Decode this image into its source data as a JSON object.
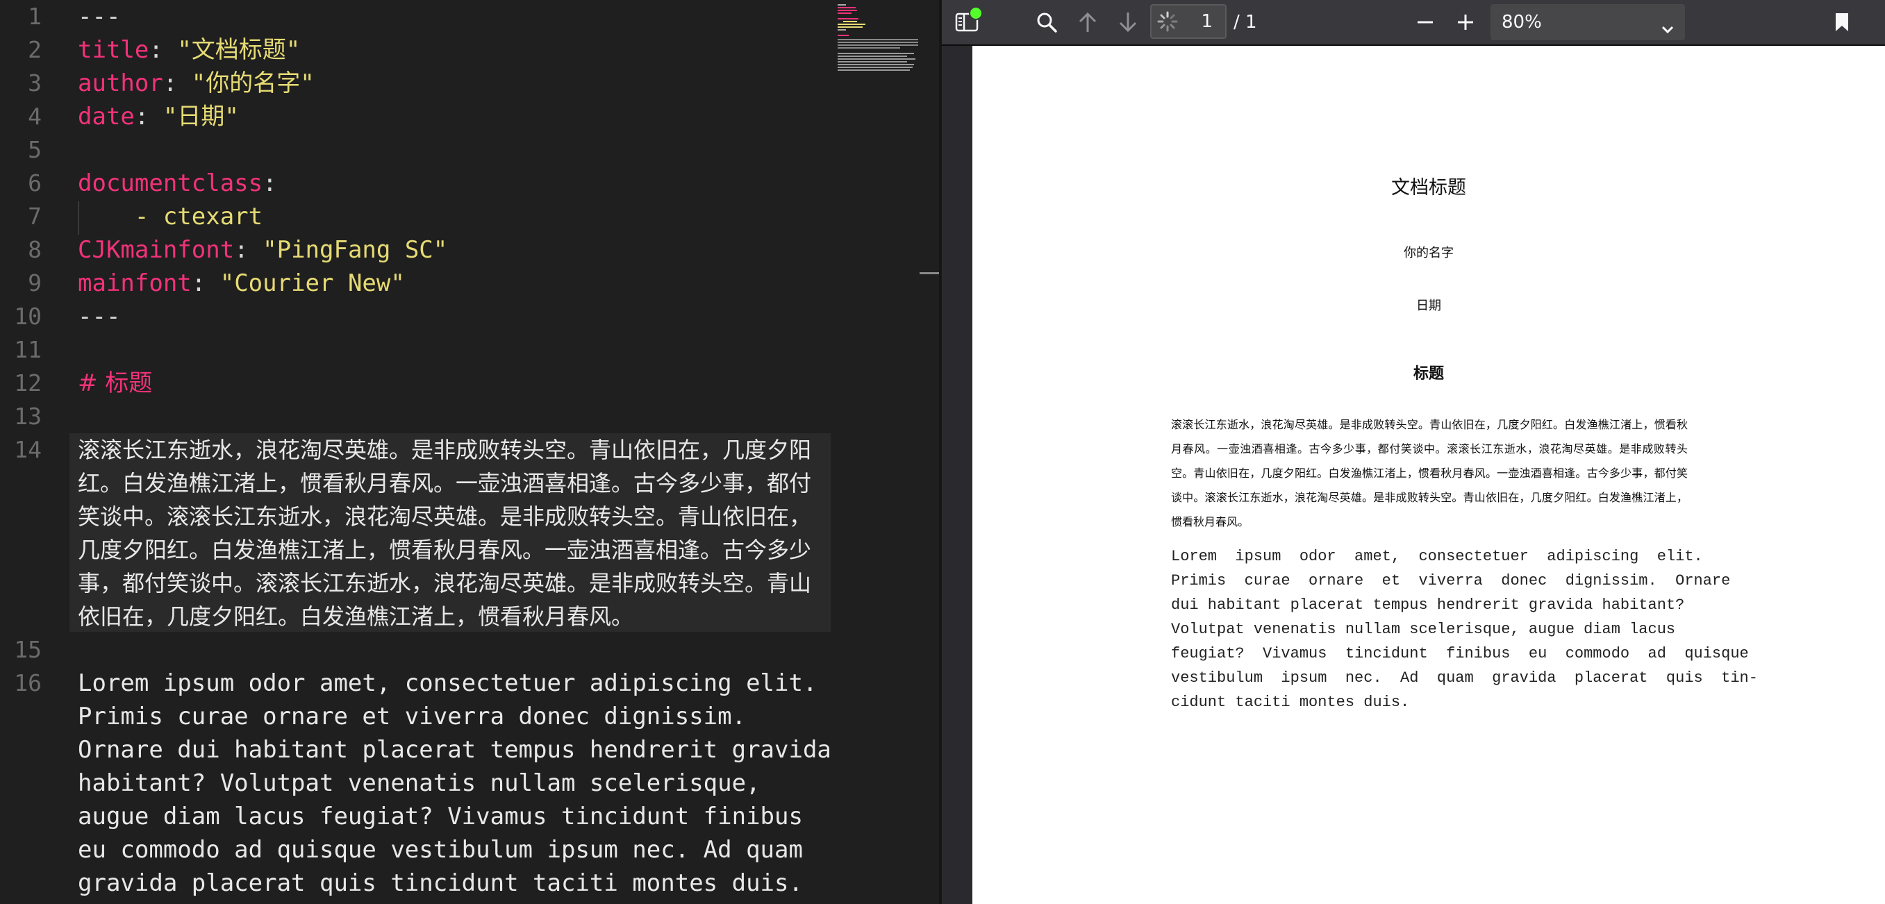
{
  "editor": {
    "line_numbers": [
      "1",
      "2",
      "3",
      "4",
      "5",
      "6",
      "7",
      "8",
      "9",
      "10",
      "11",
      "12",
      "13",
      "14",
      "15",
      "16"
    ],
    "front_matter": {
      "dashes": "---",
      "title_key": "title",
      "title_value": "\"文档标题\"",
      "author_key": "author",
      "author_value": "\"你的名字\"",
      "date_key": "date",
      "date_value": "\"日期\"",
      "docclass_key": "documentclass",
      "docclass_item": "- ctexart",
      "cjkfont_key": "CJKmainfont",
      "cjkfont_value": "\"PingFang SC\"",
      "mainfont_key": "mainfont",
      "mainfont_value": "\"Courier New\"",
      "colon": ":"
    },
    "heading": "# 标题",
    "cjk_paragraph": "滚滚长江东逝水，浪花淘尽英雄。是非成败转头空。青山依旧在，几度夕阳红。白发渔樵江渚上，惯看秋月春风。一壶浊酒喜相逢。古今多少事，都付笑谈中。滚滚长江东逝水，浪花淘尽英雄。是非成败转头空。青山依旧在，几度夕阳红。白发渔樵江渚上，惯看秋月春风。一壶浊酒喜相逢。古今多少事，都付笑谈中。滚滚长江东逝水，浪花淘尽英雄。是非成败转头空。青山依旧在，几度夕阳红。白发渔樵江渚上，惯看秋月春风。",
    "lorem_lines": [
      "Lorem ipsum odor amet, consectetuer adipiscing elit.",
      "Primis curae ornare et viverra donec dignissim.",
      "Ornare dui habitant placerat tempus hendrerit gravida",
      "habitant? Volutpat venenatis nullam scelerisque,",
      "augue diam lacus feugiat? Vivamus tincidunt finibus",
      "eu commodo ad quisque vestibulum ipsum nec. Ad quam",
      "gravida placerat quis tincidunt taciti montes duis."
    ]
  },
  "viewer": {
    "page_number": "1",
    "page_total": "/ 1",
    "zoom": "80%",
    "icons": {
      "sidebar": "sidebar-toggle-icon",
      "search": "search-icon",
      "prev": "arrow-up-icon",
      "next": "arrow-down-icon",
      "loading": "loading-spinner-icon",
      "zoom_out": "minus-icon",
      "zoom_in": "plus-icon",
      "chevron": "chevron-down-icon",
      "bookmark": "bookmark-icon"
    },
    "colors": {
      "toolbar": "#38383d",
      "badge": "#54ff2b"
    },
    "pdf": {
      "title": "文档标题",
      "author": "你的名字",
      "date": "日期",
      "section": "标题",
      "cjk_paragraph": "滚滚长江东逝水，浪花淘尽英雄。是非成败转头空。青山依旧在，几度夕阳红。白发渔樵江渚上，惯看秋月春风。一壶浊酒喜相逢。古今多少事，都付笑谈中。滚滚长江东逝水，浪花淘尽英雄。是非成败转头空。青山依旧在，几度夕阳红。白发渔樵江渚上，惯看秋月春风。一壶浊酒喜相逢。古今多少事，都付笑谈中。滚滚长江东逝水，浪花淘尽英雄。是非成败转头空。青山依旧在，几度夕阳红。白发渔樵江渚上，惯看秋月春风。",
      "latin_lines": [
        "Lorem  ipsum  odor  amet,  consectetuer  adipiscing  elit.",
        "Primis  curae  ornare  et  viverra  donec  dignissim.  Ornare",
        "dui habitant placerat tempus hendrerit gravida habitant?",
        "Volutpat venenatis nullam scelerisque, augue diam lacus",
        "feugiat?  Vivamus  tincidunt  finibus  eu  commodo  ad  quisque",
        "vestibulum  ipsum  nec.  Ad  quam  gravida  placerat  quis  tin-",
        "cidunt taciti montes duis."
      ]
    }
  }
}
